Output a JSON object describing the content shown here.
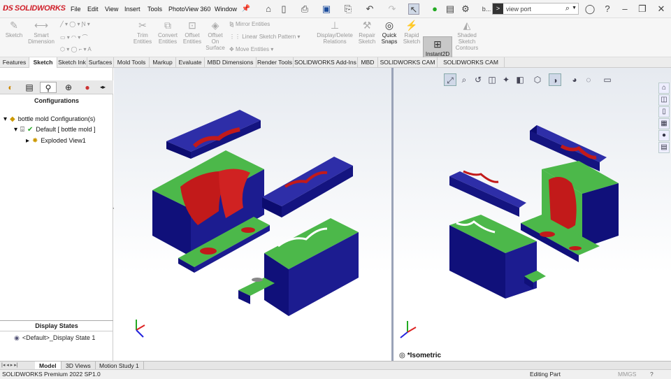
{
  "app": {
    "logo_text": "SOLIDWORKS"
  },
  "menu": [
    "File",
    "Edit",
    "View",
    "Insert",
    "Tools",
    "PhotoView 360",
    "Window"
  ],
  "toolbar": {
    "overflow_label": "b...",
    "search_placeholder": "view port",
    "search_prefix": ">"
  },
  "ribbon": {
    "buttons": [
      "Sketch",
      "Smart Dimension",
      "Trim Entities",
      "Convert Entities",
      "Offset Entities",
      "Offset On Surface",
      "Display/Delete Relations",
      "Repair Sketch",
      "Quick Snaps",
      "Rapid Sketch",
      "Instant2D",
      "Shaded Sketch Contours"
    ],
    "small": [
      "Mirror Entities",
      "Linear Sketch Pattern",
      "Move Entities"
    ]
  },
  "tabs": [
    "Features",
    "Sketch",
    "Sketch Ink",
    "Surfaces",
    "Mold Tools",
    "Markup",
    "Evaluate",
    "MBD Dimensions",
    "Render Tools",
    "SOLIDWORKS Add-Ins",
    "MBD",
    "SOLIDWORKS CAM",
    "SOLIDWORKS CAM TBM"
  ],
  "active_tab": "Sketch",
  "config_panel": {
    "heading": "Configurations",
    "root": "bottle mold Configuration(s)",
    "child": "Default [ bottle mold ]",
    "grandchild": "Exploded View1"
  },
  "display_states": {
    "heading": "Display States",
    "item": "<Default>_Display State 1"
  },
  "viewport": {
    "right_view_label": "*Isometric"
  },
  "bottom_tabs": [
    "Model",
    "3D Views",
    "Motion Study 1"
  ],
  "active_bottom_tab": "Model",
  "status": {
    "version": "SOLIDWORKS Premium 2022 SP1.0",
    "mode": "Editing Part",
    "units": "MMGS"
  },
  "colors": {
    "mold_blue": "#1a1a8c",
    "mold_green": "#4cb84a",
    "cavity_red": "#c21a1a",
    "accent": "#d0202a"
  }
}
